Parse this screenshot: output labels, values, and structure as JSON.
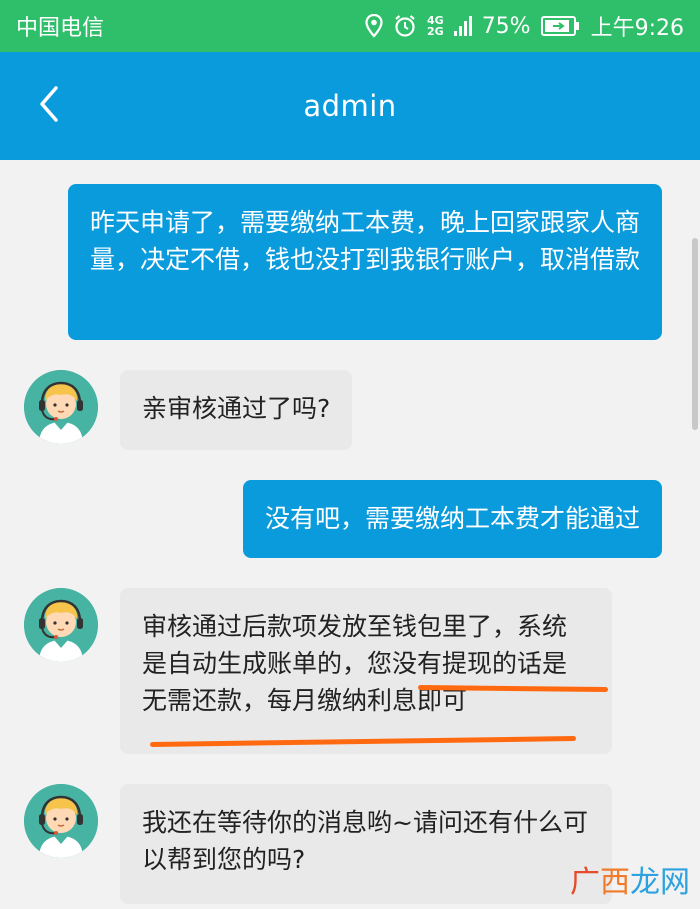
{
  "status_bar": {
    "carrier": "中国电信",
    "network_top": "4G",
    "network_bottom": "2G",
    "battery": "75%",
    "time": "上午9:26"
  },
  "header": {
    "title": "admin"
  },
  "messages": [
    {
      "side": "out",
      "text": "昨天申请了，需要缴纳工本费，晚上回家跟家人商量，决定不借，钱也没打到我银行账户，取消借款"
    },
    {
      "side": "in",
      "text": "亲审核通过了吗?"
    },
    {
      "side": "out",
      "text": "没有吧，需要缴纳工本费才能通过"
    },
    {
      "side": "in",
      "text": "审核通过后款项发放至钱包里了，系统是自动生成账单的，您没有提现的话是无需还款，每月缴纳利息即可"
    },
    {
      "side": "in",
      "text": "我还在等待你的消息哟~请问还有什么可以帮到您的吗?"
    }
  ],
  "watermark": {
    "part1": "广",
    "part2": "西",
    "part3": "龙网"
  },
  "colors": {
    "status_bar": "#2fbf6a",
    "header": "#0a9bdd",
    "outgoing_bubble": "#0a9bdd",
    "incoming_bubble": "#e9e9e9",
    "highlight_underline": "#ff6a10"
  }
}
